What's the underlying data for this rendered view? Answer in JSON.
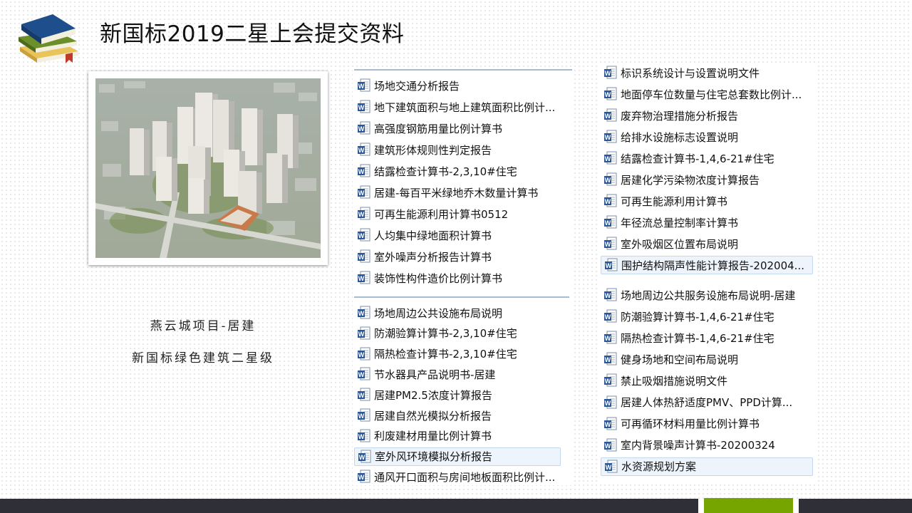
{
  "slide": {
    "title": "新国标2019二星上会提交资料"
  },
  "project": {
    "name": "燕云城项目-居建",
    "level": "新国标绿色建筑二星级"
  },
  "file_icon": "word-document-icon",
  "column1": {
    "group1": [
      "场地交通分析报告",
      "地下建筑面积与地上建筑面积比例计...",
      "高强度钢筋用量比例计算书",
      "建筑形体规则性判定报告",
      "结露检查计算书-2,3,10#住宅",
      "居建-每百平米绿地乔木数量计算书",
      "可再生能源利用计算书0512",
      "人均集中绿地面积计算书",
      "室外噪声分析报告计算书",
      "装饰性构件造价比例计算书"
    ],
    "group2": [
      "场地周边公共设施布局说明",
      "防潮验算计算书-2,3,10#住宅",
      "隔热检查计算书-2,3,10#住宅",
      "节水器具产品说明书-居建",
      "居建PM2.5浓度计算报告",
      "居建自然光模拟分析报告",
      "利废建材用量比例计算书",
      "室外风环境模拟分析报告",
      "通风开口面积与房间地板面积比例计..."
    ]
  },
  "column2": {
    "group1": [
      "标识系统设计与设置说明文件",
      "地面停车位数量与住宅总套数比例计...",
      "废弃物治理措施分析报告",
      "给排水设施标志设置说明",
      "结露检查计算书-1,4,6-21#住宅",
      "居建化学污染物浓度计算报告",
      "可再生能源利用计算书",
      "年径流总量控制率计算书",
      "室外吸烟区位置布局说明",
      "围护结构隔声性能计算报告-202004..."
    ],
    "group2": [
      "场地周边公共服务设施布局说明-居建",
      "防潮验算计算书-1,4,6-21#住宅",
      "隔热检查计算书-1,4,6-21#住宅",
      "健身场地和空间布局说明",
      "禁止吸烟措施说明文件",
      "居建人体热舒适度PMV、PPD计算...",
      "可再循环材料用量比例计算书",
      "室内背景噪声计算书-20200324",
      "水资源规划方案"
    ]
  },
  "colors": {
    "bottom_bar": "#2f2f37",
    "accent_green": "#77a500",
    "separator": "#a6bcd3",
    "word_blue": "#2b5797"
  }
}
